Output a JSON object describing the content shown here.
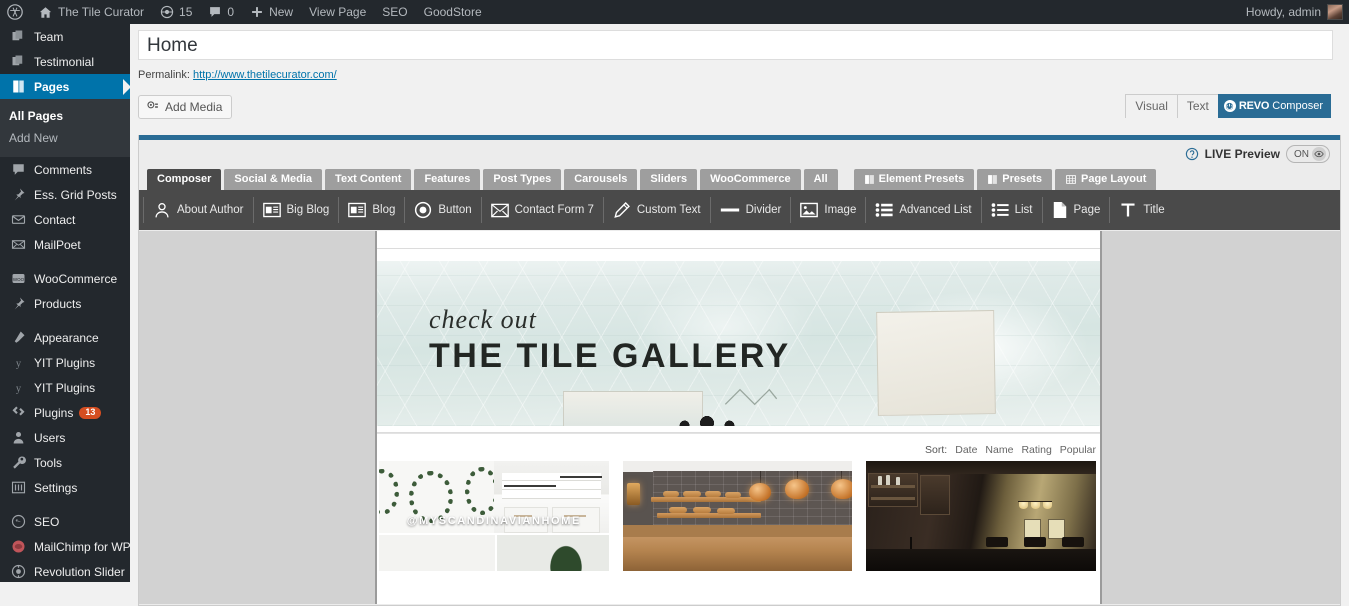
{
  "adminbar": {
    "items": [
      {
        "name": "wordpress-logo",
        "icon": "wordpress-icon",
        "label": ""
      },
      {
        "name": "site-name",
        "icon": "home-icon",
        "label": "The Tile Curator"
      },
      {
        "name": "updates",
        "icon": "updates-icon",
        "label": "15"
      },
      {
        "name": "comments",
        "icon": "comment-icon",
        "label": "0"
      },
      {
        "name": "new-content",
        "icon": "plus-icon",
        "label": "New"
      },
      {
        "name": "view-page",
        "icon": "",
        "label": "View Page"
      },
      {
        "name": "seo",
        "icon": "",
        "label": "SEO"
      },
      {
        "name": "goodstore",
        "icon": "",
        "label": "GoodStore"
      }
    ],
    "howdy": "Howdy, admin"
  },
  "sidebar": {
    "items": [
      {
        "label": "Team",
        "icon": "pages-stack-icon",
        "current": false,
        "badge": ""
      },
      {
        "label": "Testimonial",
        "icon": "pages-stack-icon",
        "current": false,
        "badge": ""
      },
      {
        "label": "Pages",
        "icon": "page-icon",
        "current": true,
        "badge": ""
      },
      {
        "label": "Comments",
        "icon": "comment-icon",
        "current": false,
        "badge": ""
      },
      {
        "label": "Ess. Grid Posts",
        "icon": "pin-icon",
        "current": false,
        "badge": ""
      },
      {
        "label": "Contact",
        "icon": "envelope-icon",
        "current": false,
        "badge": ""
      },
      {
        "label": "MailPoet",
        "icon": "mail-icon",
        "current": false,
        "badge": ""
      },
      {
        "label": "WooCommerce",
        "icon": "woo-icon",
        "current": false,
        "badge": ""
      },
      {
        "label": "Products",
        "icon": "pin-icon",
        "current": false,
        "badge": ""
      },
      {
        "label": "Appearance",
        "icon": "brush-icon",
        "current": false,
        "badge": ""
      },
      {
        "label": "YIT Plugins",
        "icon": "yit-icon",
        "current": false,
        "badge": ""
      },
      {
        "label": "YIT Plugins",
        "icon": "yit-icon",
        "current": false,
        "badge": ""
      },
      {
        "label": "Plugins",
        "icon": "plug-icon",
        "current": false,
        "badge": "13"
      },
      {
        "label": "Users",
        "icon": "user-icon",
        "current": false,
        "badge": ""
      },
      {
        "label": "Tools",
        "icon": "wrench-icon",
        "current": false,
        "badge": ""
      },
      {
        "label": "Settings",
        "icon": "sliders-icon",
        "current": false,
        "badge": ""
      },
      {
        "label": "SEO",
        "icon": "seo-icon",
        "current": false,
        "badge": ""
      },
      {
        "label": "MailChimp for WP",
        "icon": "mailchimp-icon",
        "current": false,
        "badge": ""
      },
      {
        "label": "Revolution Slider",
        "icon": "revslider-icon",
        "current": false,
        "badge": ""
      }
    ],
    "submenu": {
      "all_pages": "All Pages",
      "add_new": "Add New"
    }
  },
  "editor": {
    "page_title": "Home",
    "permalink_label": "Permalink:",
    "permalink_url": "http://www.thetilecurator.com/",
    "add_media": "Add Media",
    "tabs": [
      {
        "label": "Visual",
        "active": false
      },
      {
        "label": "Text",
        "active": false
      }
    ],
    "revo": {
      "brand": "REVO",
      "suffix": "Composer"
    }
  },
  "composer": {
    "live_preview_label": "LIVE Preview",
    "live_preview_state": "ON",
    "help_icon": "help-icon",
    "accent_color": "#2a6c95",
    "tabs": [
      {
        "label": "Composer",
        "active": true,
        "icon": ""
      },
      {
        "label": "Social & Media",
        "active": false,
        "icon": ""
      },
      {
        "label": "Text Content",
        "active": false,
        "icon": ""
      },
      {
        "label": "Features",
        "active": false,
        "icon": ""
      },
      {
        "label": "Post Types",
        "active": false,
        "icon": ""
      },
      {
        "label": "Carousels",
        "active": false,
        "icon": ""
      },
      {
        "label": "Sliders",
        "active": false,
        "icon": ""
      },
      {
        "label": "WooCommerce",
        "active": false,
        "icon": ""
      },
      {
        "label": "All",
        "active": false,
        "icon": ""
      }
    ],
    "tabs_right": [
      {
        "label": "Element Presets",
        "icon": "page-icon"
      },
      {
        "label": "Presets",
        "icon": "page-icon"
      },
      {
        "label": "Page Layout",
        "icon": "grid-icon"
      }
    ],
    "elements": [
      {
        "label": "About Author",
        "icon": "person-icon"
      },
      {
        "label": "Big Blog",
        "icon": "blog-card-icon"
      },
      {
        "label": "Blog",
        "icon": "blog-card-icon"
      },
      {
        "label": "Button",
        "icon": "button-circle-icon"
      },
      {
        "label": "Contact Form 7",
        "icon": "envelope-icon"
      },
      {
        "label": "Custom Text",
        "icon": "pencil-icon"
      },
      {
        "label": "Divider",
        "icon": "divider-icon"
      },
      {
        "label": "Image",
        "icon": "image-icon"
      },
      {
        "label": "Advanced List",
        "icon": "advanced-list-icon"
      },
      {
        "label": "List",
        "icon": "list-icon"
      },
      {
        "label": "Page",
        "icon": "page-icon"
      },
      {
        "label": "Title",
        "icon": "title-t-icon"
      }
    ]
  },
  "preview": {
    "hero": {
      "subtitle": "check out",
      "title": "THE TILE GALLERY"
    },
    "sort": {
      "label": "Sort:",
      "options": [
        "Date",
        "Name",
        "Rating",
        "Popular"
      ]
    },
    "gallery": [
      {
        "name": "scandinavian-collage",
        "overlay": "@MYSCANDINAVIANHOME"
      },
      {
        "name": "bakery-interior",
        "overlay": ""
      },
      {
        "name": "dark-wood-kitchen",
        "overlay": ""
      }
    ]
  }
}
